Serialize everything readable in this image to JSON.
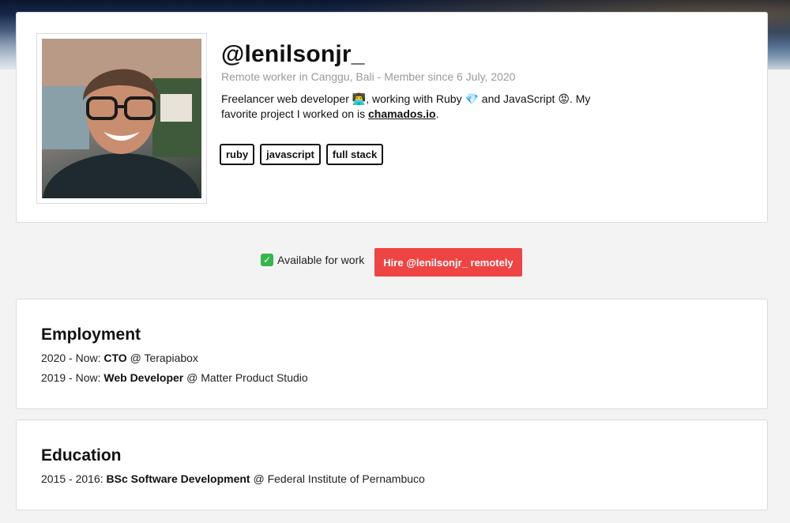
{
  "profile": {
    "handle": "@lenilsonjr_",
    "meta": "Remote worker in Canggu, Bali - Member since 6 July, 2020",
    "bio": {
      "part1": "Freelancer web developer ",
      "emoji_dev": "👨‍💻",
      "part2": ", working with Ruby ",
      "emoji_gem": "💎",
      "part3": " and JavaScript ",
      "emoji_js": "😡",
      "part4": ". My favorite project I worked on is ",
      "link": "chamados.io",
      "part5": "."
    },
    "tags": [
      "ruby",
      "javascript",
      "full stack"
    ]
  },
  "availability": {
    "check": "✓",
    "label": "Available for work"
  },
  "hire_button": "Hire @lenilsonjr_ remotely",
  "employment": {
    "title": "Employment",
    "entries": [
      {
        "period": "2020 - Now: ",
        "role": "CTO",
        "sep": " @ ",
        "org": "Terapiabox"
      },
      {
        "period": "2019 - Now: ",
        "role": "Web Developer",
        "sep": " @ ",
        "org": "Matter Product Studio"
      }
    ]
  },
  "education": {
    "title": "Education",
    "entries": [
      {
        "period": "2015 - 2016: ",
        "role": "BSc Software Development",
        "sep": " @ ",
        "org": "Federal Institute of Pernambuco"
      }
    ]
  },
  "colors": {
    "hire_button": "#ef4444",
    "check": "#33b64a"
  }
}
